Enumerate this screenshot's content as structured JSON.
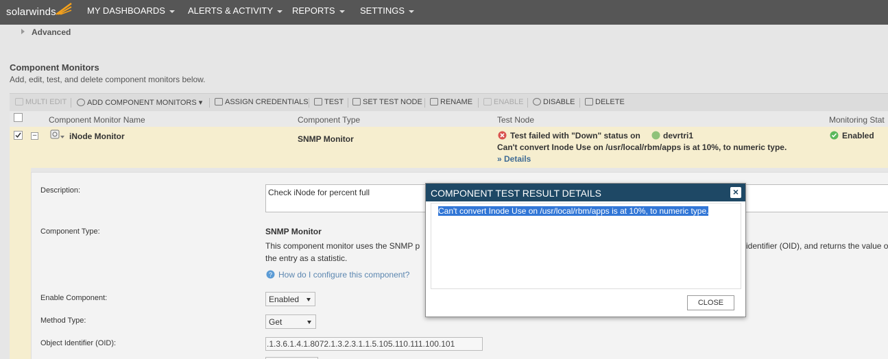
{
  "topnav": {
    "logo": "solarwinds",
    "items": [
      "MY DASHBOARDS",
      "ALERTS & ACTIVITY",
      "REPORTS",
      "SETTINGS"
    ]
  },
  "advanced_label": "Advanced",
  "section": {
    "title": "Component Monitors",
    "subtitle": "Add, edit, test, and delete component monitors below."
  },
  "toolbar": {
    "multi_edit": "MULTI EDIT",
    "add_component": "ADD COMPONENT MONITORS",
    "assign_credentials": "ASSIGN CREDENTIALS",
    "test": "TEST",
    "set_test_node": "SET TEST NODE",
    "rename": "RENAME",
    "enable": "ENABLE",
    "disable": "DISABLE",
    "delete": "DELETE"
  },
  "columns": [
    "Component Monitor Name",
    "Component Type",
    "Test Node",
    "Monitoring Stat"
  ],
  "row": {
    "name": "iNode Monitor",
    "type": "SNMP Monitor",
    "test_status": "Test failed with \"Down\" status on",
    "test_node": "devrtri1",
    "test_message": "Can't convert Inode Use on /usr/local/rbm/apps is at 10%, to numeric type.",
    "details_link": "» Details",
    "monitoring_status": "Enabled"
  },
  "detail": {
    "description_label": "Description:",
    "description_value": "Check iNode for percent full",
    "component_type_label": "Component Type:",
    "component_type_value": "SNMP Monitor",
    "component_type_desc_1": "This component monitor uses the SNMP p",
    "component_type_desc_1b": "identifier (OID), and returns the value o",
    "component_type_desc_2": "the entry as a statistic.",
    "help_link": "How do I configure this component?",
    "enable_label": "Enable Component:",
    "enable_value": "Enabled",
    "method_label": "Method Type:",
    "method_value": "Get",
    "oid_label": "Object Identifier (OID):",
    "oid_value": ".1.3.6.1.4.1.8072.1.3.2.3.1.1.5.105.110.111.100.101"
  },
  "modal": {
    "title": "COMPONENT TEST RESULT DETAILS",
    "message": "Can't convert Inode Use on /usr/local/rbm/apps is at 10%, to numeric type.",
    "close_button": "CLOSE"
  },
  "colors": {
    "topbar": "#565656",
    "modal_header": "#1e4865",
    "selected_row": "#f6eecf",
    "link": "#3f6b94",
    "error": "#d9534f",
    "ok": "#5cb85c",
    "selection": "#3176d6"
  }
}
